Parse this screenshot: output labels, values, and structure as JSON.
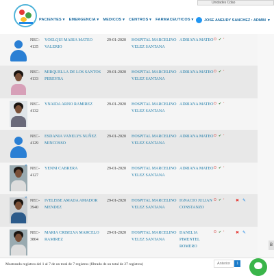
{
  "header": {
    "nav": [
      "PACIENTES",
      "EMERGENCIA",
      "MEDICOS",
      "CENTROS",
      "FARMACEUTICOS"
    ],
    "user": "JOSE ANEUDY SANCHEZ : ADMIN",
    "top_panel_text": "Unidades Cdao"
  },
  "rows": [
    {
      "id": "NEC-4135",
      "name": "YOELQUI MARIA MATEO VALERIO",
      "date": "29-01-2020",
      "hospital": "HOSPITAL MARCELINO VELEZ SANTANA",
      "doctor": "ADRIANA MATEO",
      "photo": "placeholder"
    },
    {
      "id": "NEC-4133",
      "name": "MIRQUELLA DE LOS SANTOS PEREYRA",
      "date": "29-01-2020",
      "hospital": "HOSPITAL MARCELINO VELEZ SANTANA",
      "doctor": "ADRIANA MATEO",
      "photo": "person"
    },
    {
      "id": "NEC-4132",
      "name": "YNAIDA ARNO RAMIREZ",
      "date": "29-01-2020",
      "hospital": "HOSPITAL MARCELINO VELEZ SANTANA",
      "doctor": "ADRIANA MATEO",
      "photo": "person"
    },
    {
      "id": "NEC-4129",
      "name": "ESDANIA VANELYS NUÑEZ MINCOSSO",
      "date": "29-01-2020",
      "hospital": "HOSPITAL MARCELINO VELEZ SANTANA",
      "doctor": "ADRIANA MATEO",
      "photo": "placeholder"
    },
    {
      "id": "NEC-4127",
      "name": "YENNI CABRERA",
      "date": "29-01-2020",
      "hospital": "HOSPITAL MARCELINO VELEZ SANTANA",
      "doctor": "ADRIANA MATEO",
      "photo": "person"
    },
    {
      "id": "NEC-3940",
      "name": "IVELISSE AMADA AMADOR MENDEZ",
      "date": "29-01-2020",
      "hospital": "HOSPITAL MARCELINO VELEZ SANTANA",
      "doctor": "IGNACIO JULIAN CONSTANZO",
      "photo": "person"
    },
    {
      "id": "NEC-3804",
      "name": "MARIA CRISELVA MARCELO RAMIREZ",
      "date": "29-01-2020",
      "hospital": "HOSPITAL MARCELINO VELEZ SANTANA",
      "doctor": "DANELIA PIMENTEL ROMERO",
      "photo": "person"
    }
  ],
  "footer": {
    "info": "Mostrando registros del 1 al 7 de un total de 7 registros (filtrado de un total de 27 registros)",
    "prev": "Anterior",
    "page": "1"
  },
  "right_button": "B",
  "colors": {
    "link": "#1a7aa8",
    "row_alt": "#e8e8e8",
    "accent": "#1a7ac8"
  }
}
